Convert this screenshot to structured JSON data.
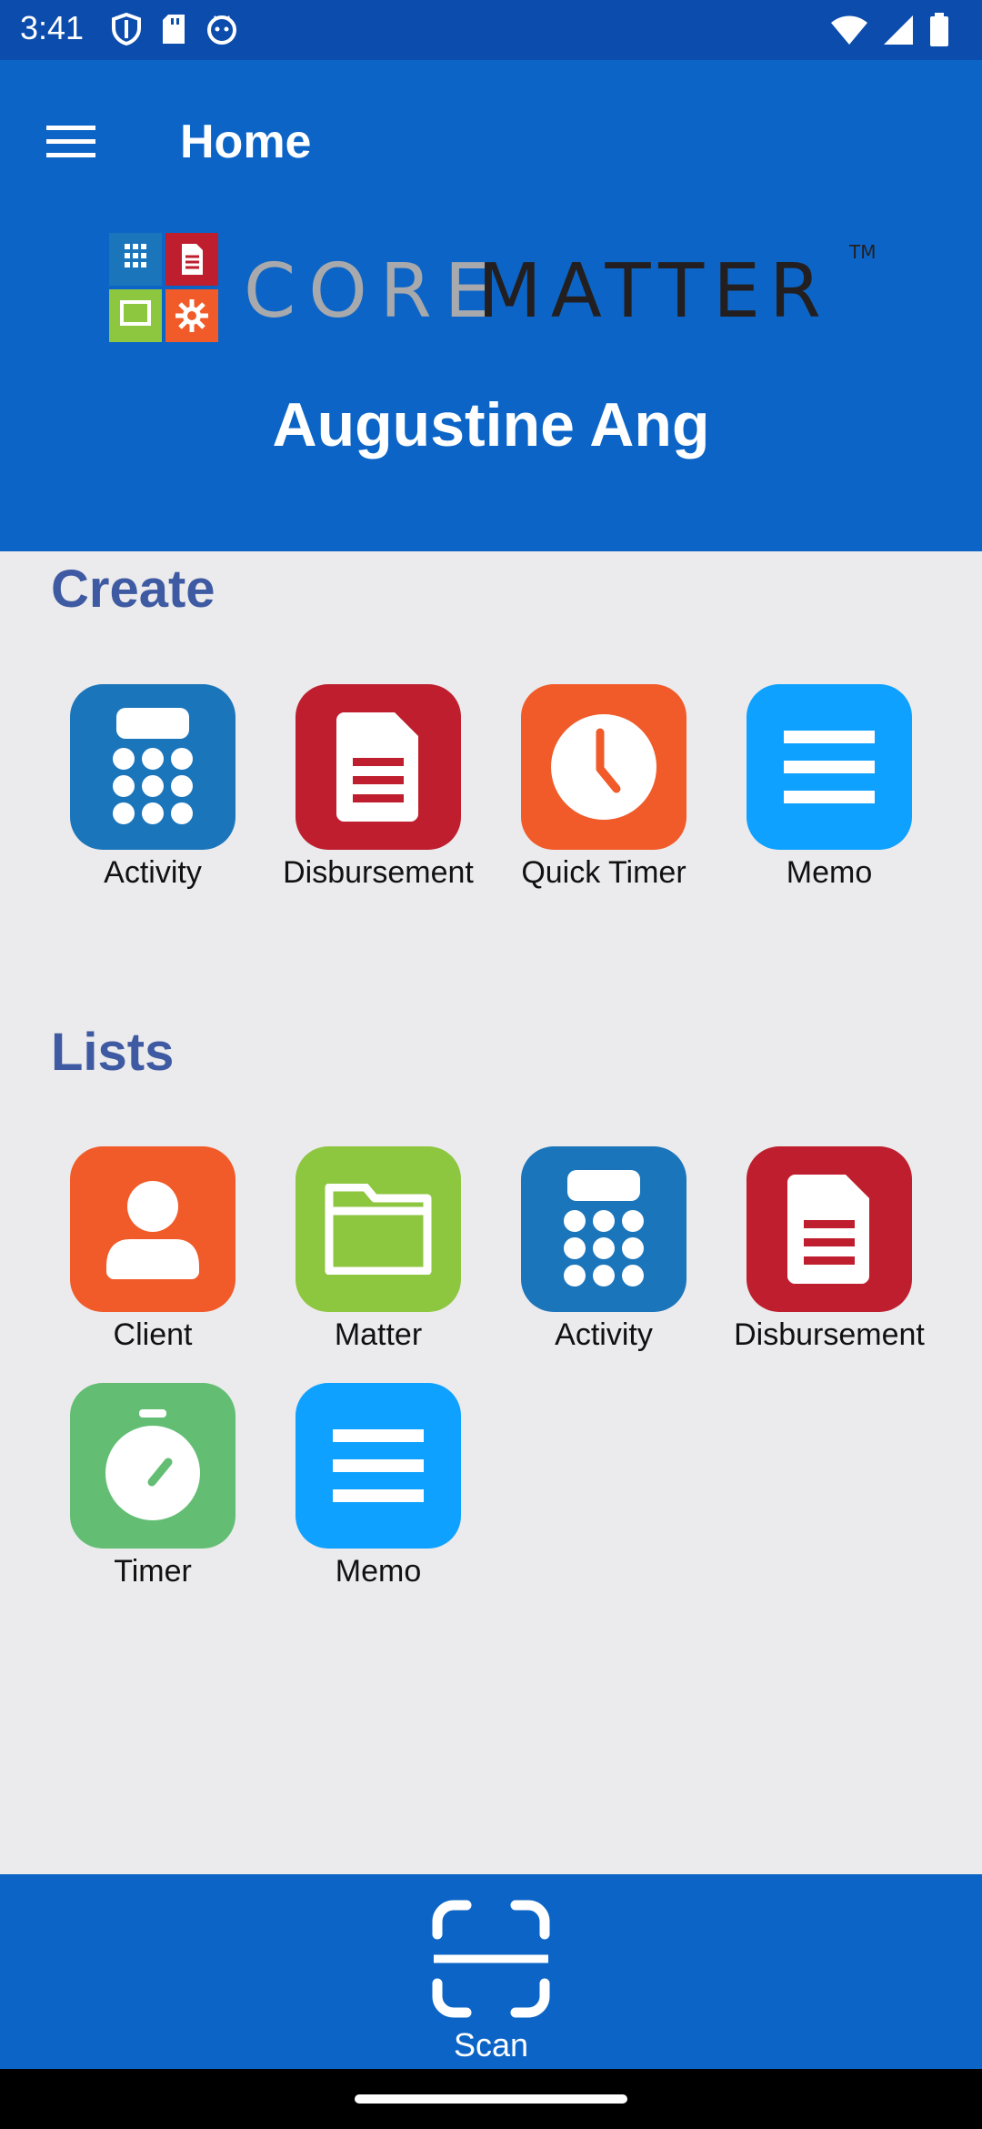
{
  "status_bar": {
    "time": "3:41",
    "left_icons": [
      "shield-icon",
      "sd-card-icon",
      "cat-face-icon"
    ],
    "right_icons": [
      "wifi-icon",
      "signal-icon",
      "battery-icon"
    ]
  },
  "app_bar": {
    "menu_icon": "hamburger-menu-icon",
    "title": "Home",
    "logo": {
      "text_core": "CORE",
      "text_matter": "MATTER",
      "trademark": "TM"
    },
    "user_name": "Augustine Ang"
  },
  "create": {
    "title": "Create",
    "items": [
      {
        "label": "Activity",
        "icon": "calculator-icon",
        "color": "#1b75bb"
      },
      {
        "label": "Disbursement",
        "icon": "document-icon",
        "color": "#be1e2d"
      },
      {
        "label": "Quick Timer",
        "icon": "clock-icon",
        "color": "#f15a29"
      },
      {
        "label": "Memo",
        "icon": "memo-lines-icon",
        "color": "#0ea1ff"
      }
    ]
  },
  "lists": {
    "title": "Lists",
    "items": [
      {
        "label": "Client",
        "icon": "person-icon",
        "color": "#f15a29"
      },
      {
        "label": "Matter",
        "icon": "folder-icon",
        "color": "#8dc63f"
      },
      {
        "label": "Activity",
        "icon": "calculator-icon",
        "color": "#1b75bb"
      },
      {
        "label": "Disbursement",
        "icon": "document-icon",
        "color": "#be1e2d"
      },
      {
        "label": "Timer",
        "icon": "stopwatch-icon",
        "color": "#63be74"
      },
      {
        "label": "Memo",
        "icon": "memo-lines-icon",
        "color": "#0ea1ff"
      }
    ]
  },
  "bottom_bar": {
    "scan_label": "Scan",
    "scan_icon": "scan-frame-icon"
  },
  "colors": {
    "status_bar": "#0b4cac",
    "app_bar": "#0c65c6",
    "background": "#ebeaec",
    "section_title": "#3e5aa2"
  }
}
